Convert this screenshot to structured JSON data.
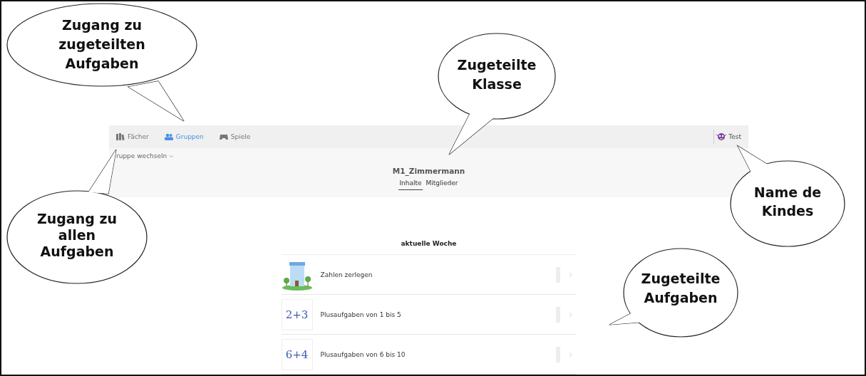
{
  "nav": {
    "items": [
      {
        "label": "Fächer",
        "kind": "books",
        "selected": false
      },
      {
        "label": "Gruppen",
        "kind": "people",
        "selected": true
      },
      {
        "label": "Spiele",
        "kind": "gamepad",
        "selected": false
      }
    ],
    "user": {
      "name": "Test"
    }
  },
  "group": {
    "switch_label": "ruppe wechseln",
    "name": "M1_Zimmermann",
    "tabs": [
      {
        "label": "Inhalte",
        "selected": true
      },
      {
        "label": "Mitglieder",
        "selected": false
      }
    ]
  },
  "section_title": "aktuelle Woche",
  "tasks": [
    {
      "title": "Zahlen zerlegen",
      "kind": "picture"
    },
    {
      "title": "Plusaufgaben von 1 bis 5",
      "kind": "sum",
      "thumb_text": "2+3"
    },
    {
      "title": "Plusaufgaben von 6 bis 10",
      "kind": "sum",
      "thumb_text": "6+4"
    }
  ],
  "callouts": [
    {
      "lines": [
        "Zugang zu",
        "zugeteilten",
        "Aufgaben"
      ]
    },
    {
      "lines": [
        "Zugeteilte",
        "Klasse"
      ]
    },
    {
      "lines": [
        "Zugang zu",
        "allen",
        "Aufgaben"
      ]
    },
    {
      "lines": [
        "Name de",
        "Kindes"
      ]
    },
    {
      "lines": [
        "Zugeteilte",
        "Aufgaben"
      ]
    }
  ]
}
